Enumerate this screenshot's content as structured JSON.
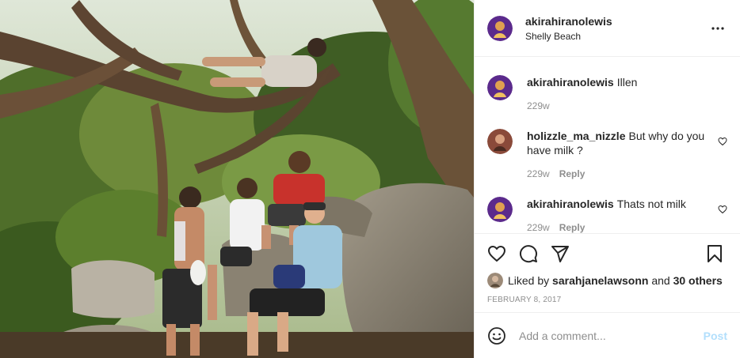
{
  "post": {
    "username": "akirahiranolewis",
    "location": "Shelly Beach",
    "more_icon": "more-horizontal-icon"
  },
  "comments": [
    {
      "username": "akirahiranolewis",
      "text": "Illen",
      "time": "229w",
      "reply": "",
      "avatar_color": "#5b2a8c"
    },
    {
      "username": "holizzle_ma_nizzle",
      "text": "But why do you have milk ?",
      "time": "229w",
      "reply": "Reply",
      "avatar_color": "#8a4a3a"
    },
    {
      "username": "akirahiranolewis",
      "text": "Thats not milk",
      "time": "229w",
      "reply": "Reply",
      "avatar_color": "#5b2a8c"
    }
  ],
  "actions": {
    "like_icon": "heart-icon",
    "comment_icon": "comment-icon",
    "share_icon": "paper-plane-icon",
    "save_icon": "bookmark-icon"
  },
  "likes": {
    "prefix": "Liked by",
    "user": "sarahjanelawsonn",
    "conjunction": "and",
    "others": "30 others"
  },
  "date": "FEBRUARY 8, 2017",
  "add_comment": {
    "placeholder": "Add a comment...",
    "post_label": "Post"
  },
  "colors": {
    "text": "#262626",
    "muted": "#8e8e8e",
    "post_disabled": "#b2dffc",
    "border": "#efefef"
  }
}
